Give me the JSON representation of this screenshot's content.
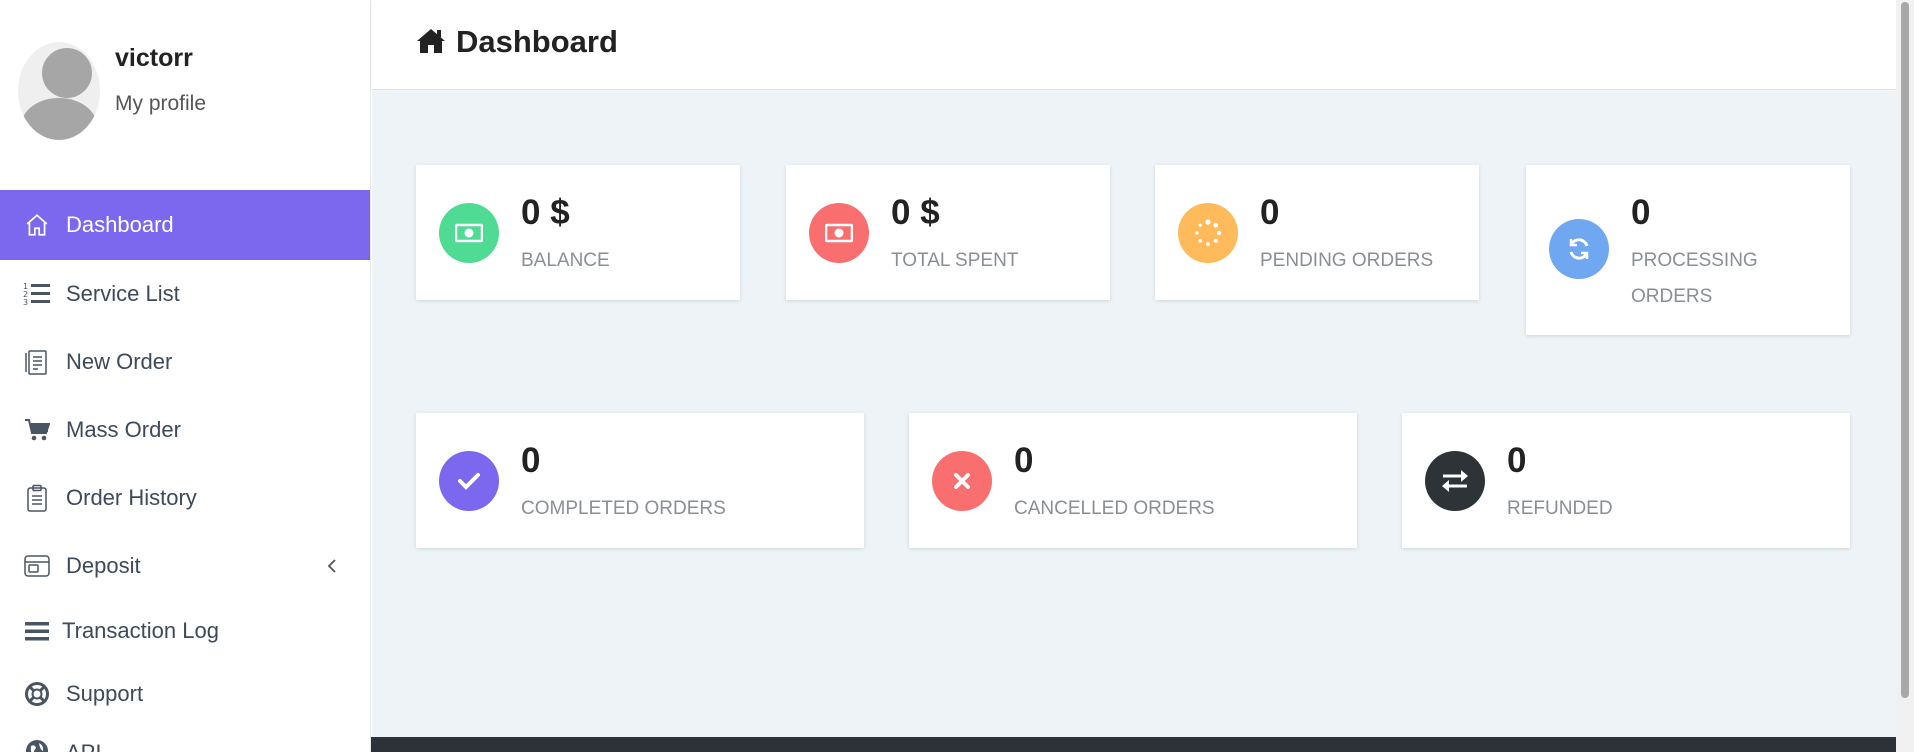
{
  "profile": {
    "username": "victorr",
    "profile_link": "My profile"
  },
  "sidebar": {
    "items": [
      {
        "label": "Dashboard",
        "icon": "home-outline-icon",
        "active": true
      },
      {
        "label": "Service List",
        "icon": "numbered-list-icon"
      },
      {
        "label": "New Order",
        "icon": "receipt-icon"
      },
      {
        "label": "Mass Order",
        "icon": "cart-icon"
      },
      {
        "label": "Order History",
        "icon": "clipboard-icon"
      },
      {
        "label": "Deposit",
        "icon": "wallet-icon",
        "has_submenu": true
      },
      {
        "label": "Transaction Log",
        "icon": "bars-icon"
      },
      {
        "label": "Support",
        "icon": "lifebuoy-icon"
      },
      {
        "label": "API",
        "icon": "globe-icon"
      }
    ]
  },
  "header": {
    "title": "Dashboard",
    "icon": "home-icon"
  },
  "stats": {
    "balance": {
      "value": "0 $",
      "label": "BALANCE",
      "color": "#4fdb93",
      "icon": "money-bill-icon"
    },
    "total_spent": {
      "value": "0 $",
      "label": "TOTAL SPENT",
      "color": "#f96f6f",
      "icon": "money-bill-icon"
    },
    "pending": {
      "value": "0",
      "label": "PENDING ORDERS",
      "color": "#ffba5c",
      "icon": "spinner-icon"
    },
    "processing": {
      "value": "0",
      "label": "PROCESSING ORDERS",
      "color": "#6fa8f0",
      "icon": "refresh-icon"
    },
    "completed": {
      "value": "0",
      "label": "COMPLETED ORDERS",
      "color": "#7b68ee",
      "icon": "check-icon"
    },
    "cancelled": {
      "value": "0",
      "label": "CANCELLED ORDERS",
      "color": "#f96f6f",
      "icon": "times-icon"
    },
    "refunded": {
      "value": "0",
      "label": "REFUNDED",
      "color": "#2e3338",
      "icon": "exchange-icon"
    }
  },
  "colors": {
    "accent": "#7b68ee",
    "main_background": "#edf3f6",
    "footer": "#2c323a"
  }
}
